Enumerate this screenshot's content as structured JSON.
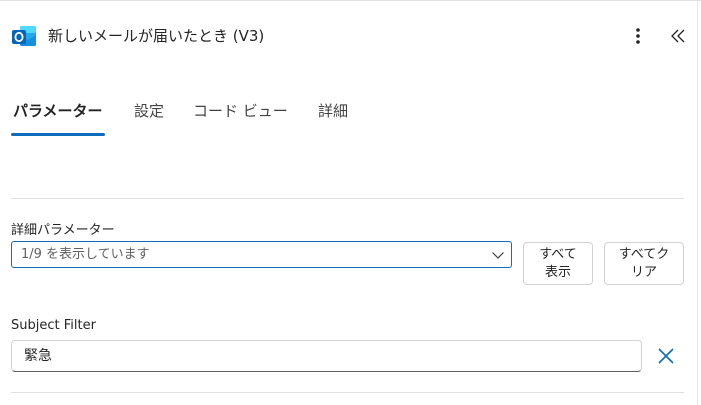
{
  "header": {
    "title": "新しいメールが届いたとき (V3)",
    "app_icon": "outlook-icon",
    "more_icon": "more-vertical-icon",
    "collapse_icon": "double-chevron-left-icon"
  },
  "tabs": [
    {
      "label": "パラメーター",
      "active": true
    },
    {
      "label": "設定",
      "active": false
    },
    {
      "label": "コード ビュー",
      "active": false
    },
    {
      "label": "詳細",
      "active": false
    }
  ],
  "advanced_params": {
    "label": "詳細パラメーター",
    "select_value": "1/9 を表示しています",
    "chevron_icon": "chevron-down-icon",
    "show_all_label": "すべて\n表示",
    "clear_all_label": "すべてク\nリア"
  },
  "subject_filter": {
    "label": "Subject Filter",
    "value": "緊急",
    "clear_icon": "close-icon"
  },
  "colors": {
    "accent": "#0f6cbd",
    "outlook_blue": "#0364b8",
    "text": "#242424",
    "border": "#d1d1d1"
  }
}
